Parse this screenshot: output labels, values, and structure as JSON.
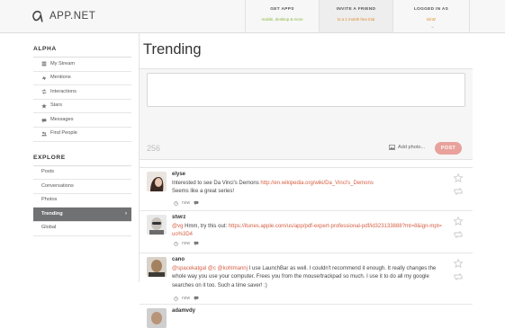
{
  "brand": {
    "name": "APP.NET"
  },
  "topnav": [
    {
      "title": "GET APPS",
      "sub": "mobile, desktop & more",
      "sub_color": "green"
    },
    {
      "title": "INVITE A FRIEND",
      "sub": "to a 1 month free trial",
      "sub_color": "orange"
    },
    {
      "title": "LOGGED IN AS",
      "sub": "mintz",
      "sub_color": "orange"
    }
  ],
  "sidebar": {
    "section1": "ALPHA",
    "alpha_items": [
      {
        "label": "My Stream",
        "icon": "stream-icon"
      },
      {
        "label": "Mentions",
        "icon": "mentions-icon"
      },
      {
        "label": "Interactions",
        "icon": "interactions-icon"
      },
      {
        "label": "Stars",
        "icon": "star-icon"
      },
      {
        "label": "Messages",
        "icon": "messages-icon"
      },
      {
        "label": "Find People",
        "icon": "people-icon"
      }
    ],
    "section2": "EXPLORE",
    "explore_items": [
      {
        "label": "Posts"
      },
      {
        "label": "Conversations"
      },
      {
        "label": "Photos"
      },
      {
        "label": "Trending",
        "active": true
      },
      {
        "label": "Global"
      }
    ]
  },
  "main": {
    "title": "Trending",
    "composer": {
      "char_count": "256",
      "add_photo": "Add photo...",
      "post_button": "POST"
    }
  },
  "posts": [
    {
      "username": "elyse",
      "text_plain": "Interested to see Da Vinci's Demons ",
      "link": "http://en.wikipedia.org/wiki/Da_Vinci's_Demons",
      "text_after": "Seems like a great series!",
      "time": "now"
    },
    {
      "username": "stwrz",
      "mention": "@vg",
      "text_plain": " Hmm, try this out: ",
      "link": "https://itunes.apple.com/us/app/pdf-expert-professional-pdf/id323133888?mt=8&ign-mpt=uo%3D4",
      "time": "now"
    },
    {
      "username": "cano",
      "mention": "@spacekatgal @c @kohlmannj",
      "text_plain": " I use LaunchBar as well. I couldn't recommend it enough. It really changes the whole way you use your computer. Frees you from the mouse/trackpad so much. I use it to do all my google searches on it too. Such a time saver! :)",
      "time": "now"
    },
    {
      "username": "adamvdy"
    }
  ],
  "colors": {
    "accent_green": "#89b843",
    "accent_orange": "#e08a2a",
    "link": "#d55f43",
    "post_button": "#e8a29b",
    "sidebar_active": "#6f7173"
  }
}
